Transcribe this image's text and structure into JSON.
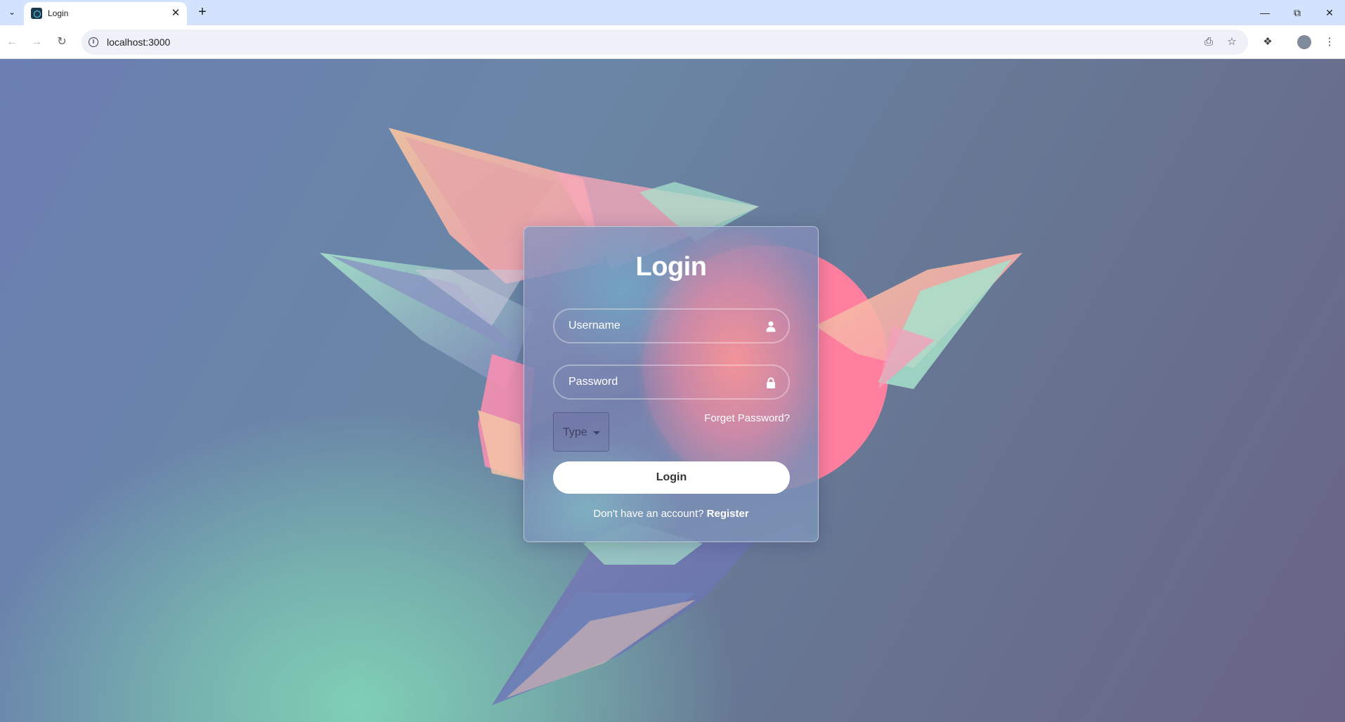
{
  "browser": {
    "tab_title": "Login",
    "url": "localhost:3000",
    "icons": {
      "tab_list": "chevron-down-icon",
      "tab_close": "close-icon",
      "new_tab": "plus-icon",
      "back": "arrow-left-icon",
      "forward": "arrow-right-icon",
      "reload": "reload-icon",
      "site_info": "info-icon",
      "install": "install-app-icon",
      "bookmark": "star-icon",
      "extensions": "puzzle-icon",
      "profile": "avatar",
      "menu": "kebab-menu-icon",
      "minimize": "minimize-icon",
      "maximize": "restore-icon",
      "close_window": "close-icon"
    }
  },
  "login_card": {
    "title": "Login",
    "username_placeholder": "Username",
    "password_placeholder": "Password",
    "type_select_label": "Type",
    "forgot_password": "Forget Password?",
    "login_button": "Login",
    "register_prompt": "Don't have an account?",
    "register_link": "Register"
  },
  "colors": {
    "tab_strip": "#d3e3fd",
    "card_border": "#ffffff",
    "login_button_bg": "#ffffff",
    "accent_pink": "#ff7f9e",
    "accent_teal": "#7fcfb5"
  }
}
